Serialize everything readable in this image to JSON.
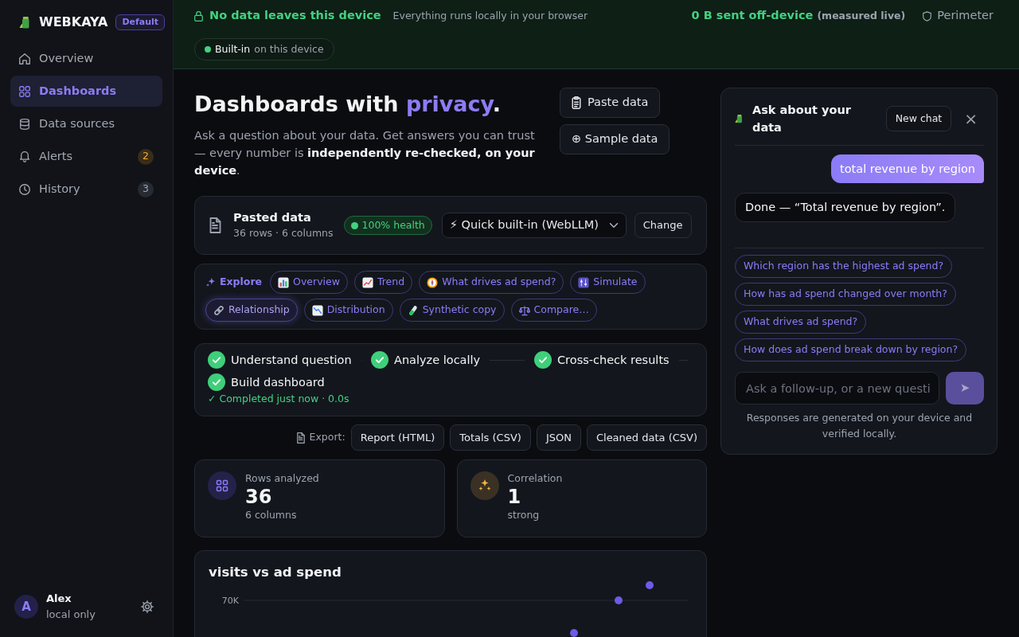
{
  "sidebar": {
    "brand": "WEBKAYA",
    "workspace": "Default",
    "items": [
      {
        "label": "Overview",
        "selected": false
      },
      {
        "label": "Dashboards",
        "selected": true
      },
      {
        "label": "Data sources",
        "selected": false
      },
      {
        "label": "Alerts",
        "selected": false,
        "badge": {
          "text": "2",
          "kind": "warning"
        }
      },
      {
        "label": "History",
        "selected": false,
        "badge": {
          "text": "3",
          "kind": "neutral"
        }
      }
    ],
    "user": {
      "initial": "A",
      "name": "Alex",
      "subtitle": "local only"
    }
  },
  "privacy_bar": {
    "title": "No data leaves this device",
    "subtitle": "Everything runs locally in your browser",
    "traffic": "0 B sent off-device",
    "traffic_note": "(measured live)",
    "perimeter": "Perimeter",
    "engine": {
      "label": "Built-in",
      "detail": "on this device"
    }
  },
  "hero": {
    "title": [
      {
        "text": "Dashboards with ",
        "accent": false
      },
      {
        "text": "privacy",
        "accent": true
      },
      {
        "text": ".",
        "accent": false
      }
    ],
    "description": "Ask a question about your data. Get answers you can trust — every number is **independently re-checked, on your device**.",
    "actions": [
      "Paste data",
      "⊕ Sample data"
    ]
  },
  "dataset": {
    "name": "Pasted data",
    "meta": "36 rows · 6 columns",
    "health": "100% health",
    "model": "⚡ Quick built-in (WebLLM)",
    "change": "Change"
  },
  "explore": {
    "label": "Explore",
    "chips": [
      {
        "label": "Overview",
        "selected": false
      },
      {
        "label": "Trend",
        "selected": false
      },
      {
        "label": "What drives ad spend?",
        "selected": false
      },
      {
        "label": "Simulate",
        "selected": false
      },
      {
        "label": "Relationship",
        "selected": true
      },
      {
        "label": "Distribution",
        "selected": false
      },
      {
        "label": "Synthetic copy",
        "selected": false
      },
      {
        "label": "Compare…",
        "selected": false
      }
    ]
  },
  "pipeline": {
    "steps": [
      {
        "label": "Understand question",
        "done": true
      },
      {
        "label": "Analyze locally",
        "done": true
      },
      {
        "label": "Cross-check results",
        "done": true
      },
      {
        "label": "Build dashboard",
        "done": true
      }
    ],
    "status": "✓ Completed just now · 0.0s"
  },
  "export": {
    "label": "Export:",
    "buttons": [
      "Report (HTML)",
      "Totals (CSV)",
      "JSON",
      "Cleaned data (CSV)"
    ]
  },
  "stats": [
    {
      "label": "Rows analyzed",
      "value": "36",
      "note": "6 columns"
    },
    {
      "label": "Correlation",
      "value": "1",
      "note": "strong"
    }
  ],
  "chart_card": {
    "title": "visits vs ad spend",
    "tick_label": "70K"
  },
  "chat": {
    "title": "Ask about your data",
    "new_chat": "New chat",
    "close": "×",
    "messages": [
      {
        "kind": "user",
        "text": "total revenue by region"
      },
      {
        "kind": "assistant",
        "text": "Done — “Total revenue by region”."
      }
    ],
    "suggestions": [
      "Which region has the highest ad spend?",
      "How has ad spend changed over month?",
      "What drives ad spend?",
      "How does ad spend break down by region?"
    ],
    "input": {
      "placeholder": "Ask a follow-up, or a new questi"
    },
    "send": {
      "label": "➤",
      "disabled": true
    },
    "footer": "Responses are generated on your device and verified locally."
  }
}
